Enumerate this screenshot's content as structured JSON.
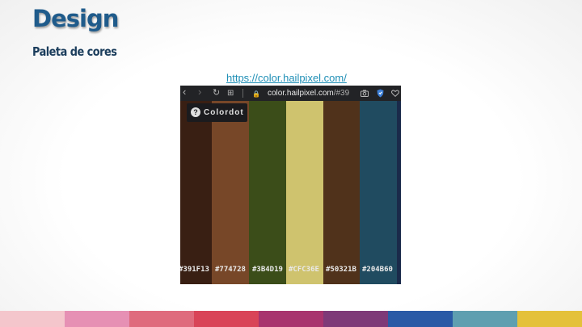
{
  "slide": {
    "title": "Design",
    "subtitle": "Paleta de cores",
    "link_text": "https://color.hailpixel.com/"
  },
  "browser": {
    "nav_back_glyph": "‹",
    "nav_forward_glyph": "›",
    "reload_glyph": "↻",
    "tabs_glyph": "⊞",
    "lock_glyph": "🔒",
    "url_domain": "color.hailpixel.com",
    "url_path": "/#39",
    "badge_label": "Colordot",
    "icons": [
      "back-icon",
      "forward-icon",
      "reload-icon",
      "tabs-grid-icon",
      "lock-icon",
      "camera-icon",
      "shield-icon",
      "heart-icon",
      "help-icon"
    ]
  },
  "palette": {
    "swatches": [
      {
        "hex": "#391F13",
        "label": "#391F13"
      },
      {
        "hex": "#774728",
        "label": "#774728"
      },
      {
        "hex": "#3B4D19",
        "label": "#3B4D19"
      },
      {
        "hex": "#CFC36E",
        "label": "#CFC36E"
      },
      {
        "hex": "#50321B",
        "label": "#50321B"
      },
      {
        "hex": "#204B60",
        "label": "#204B60"
      },
      {
        "hex": "#1A2A4A",
        "label": ""
      }
    ]
  },
  "theme": {
    "title_color": "#1f5b8b",
    "bottom_bar_colors": [
      "#f4c6cc",
      "#e690b4",
      "#df6b7d",
      "#d94458",
      "#a8346e",
      "#7e3a78",
      "#2a5aa6",
      "#5f9fb0",
      "#e4c13a"
    ]
  }
}
